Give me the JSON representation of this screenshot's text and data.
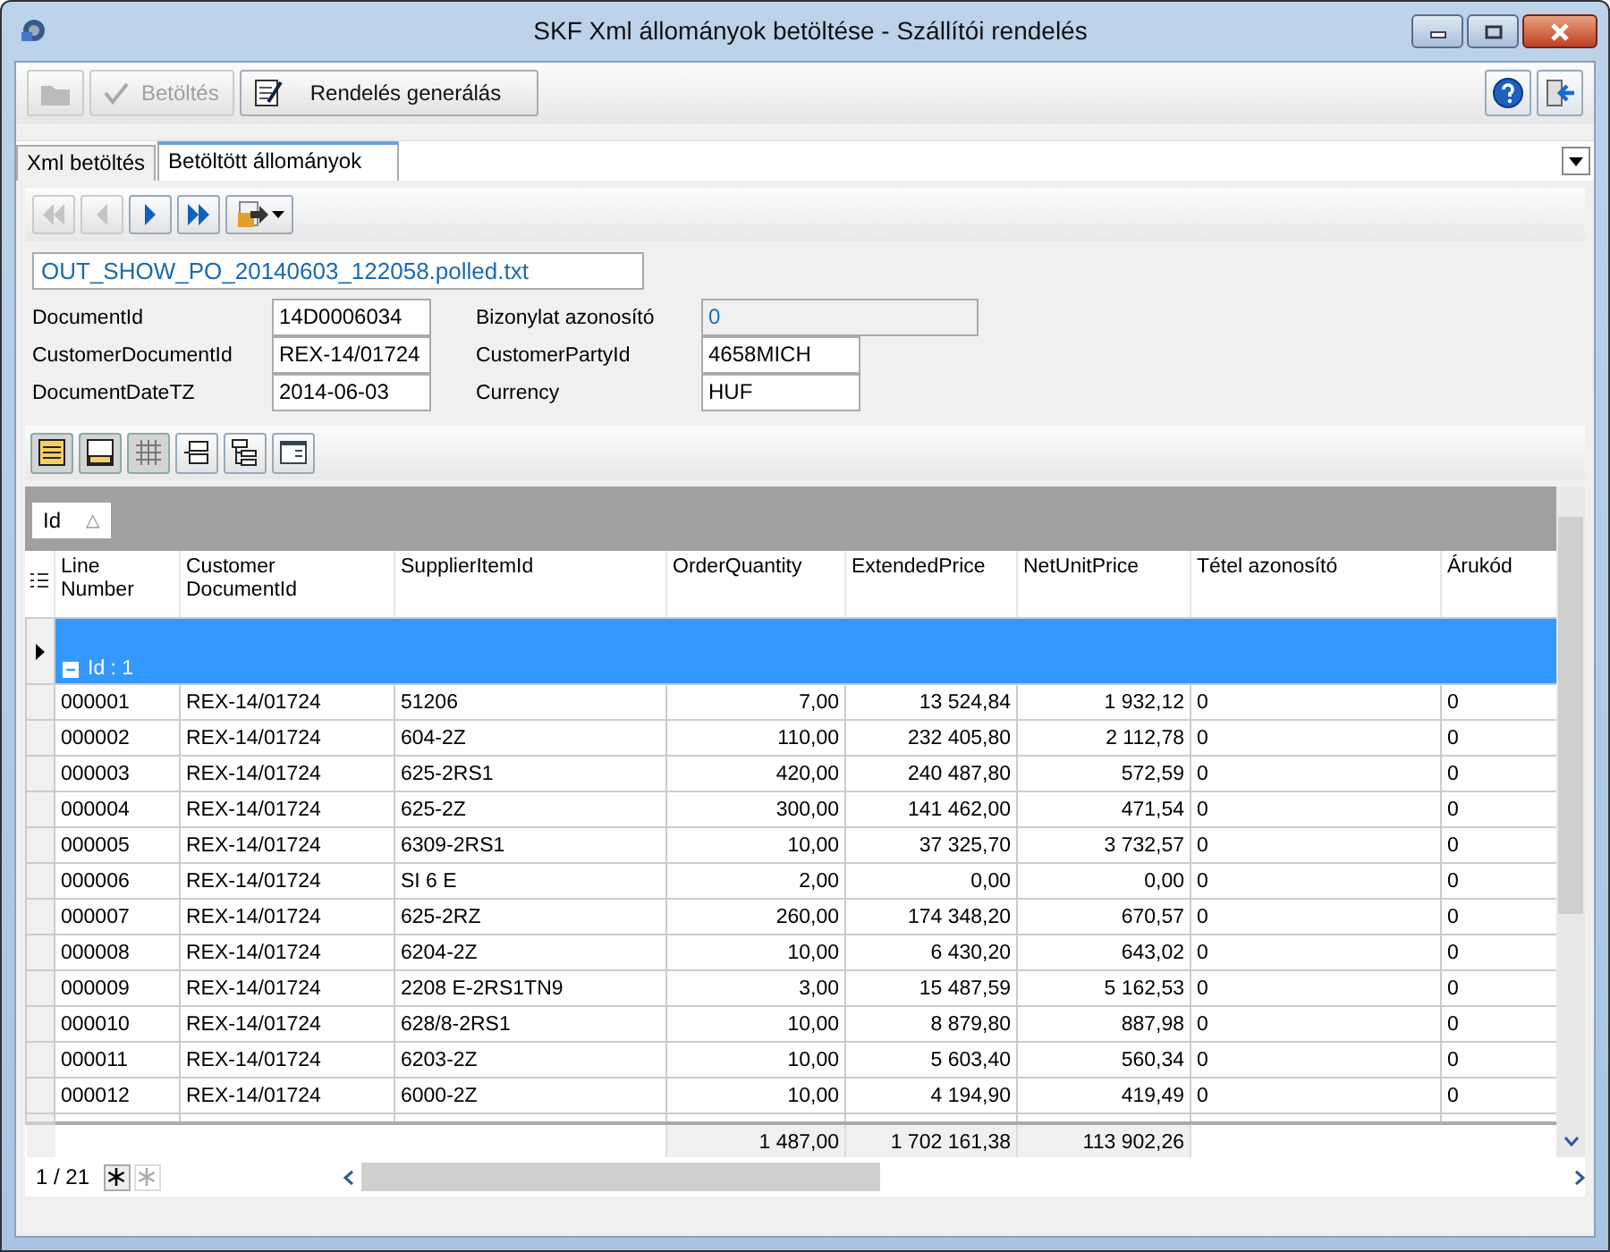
{
  "window": {
    "title": "SKF Xml állományok betöltése - Szállítói rendelés"
  },
  "toolbar": {
    "buttons": [
      {
        "kind": "open",
        "disabled": true
      },
      {
        "kind": "check",
        "label": "Betöltés",
        "disabled": true
      },
      {
        "kind": "generate",
        "label": "Rendelés generálás",
        "disabled": false
      }
    ],
    "right_buttons": [
      {
        "kind": "help"
      },
      {
        "kind": "exit"
      }
    ]
  },
  "tabs": [
    {
      "label": "Xml betöltés",
      "selected": false
    },
    {
      "label": "Betöltött állományok",
      "selected": true
    }
  ],
  "nav": [
    {
      "kind": "first",
      "disabled": true
    },
    {
      "kind": "prev",
      "disabled": true
    },
    {
      "kind": "next",
      "disabled": false
    },
    {
      "kind": "last",
      "disabled": false
    },
    {
      "kind": "export",
      "disabled": false
    }
  ],
  "file_name": "OUT_SHOW_PO_20140603_122058.polled.txt",
  "fields_left": [
    {
      "label": "DocumentId",
      "value": "14D0006034"
    },
    {
      "label": "CustomerDocumentId",
      "value": "REX-14/01724"
    },
    {
      "label": "DocumentDateTZ",
      "value": "2014-06-03"
    }
  ],
  "fields_right": [
    {
      "label": "Bizonylat azonosító",
      "value": "0",
      "disabled": true
    },
    {
      "label": "CustomerPartyId",
      "value": "4658MICH",
      "disabled": false
    },
    {
      "label": "Currency",
      "value": "HUF",
      "disabled": false
    }
  ],
  "view_buttons": [
    {
      "kind": "form",
      "pressed": true
    },
    {
      "kind": "footer",
      "pressed": true
    },
    {
      "kind": "grid",
      "pressed": true
    },
    {
      "kind": "group",
      "pressed": false
    },
    {
      "kind": "tree",
      "pressed": false
    },
    {
      "kind": "card",
      "pressed": false
    }
  ],
  "group_by": {
    "label": "Id",
    "sort": "△"
  },
  "table": {
    "columns": [
      {
        "label": "Line Number",
        "kind": "text"
      },
      {
        "label": "Customer DocumentId",
        "kind": "text"
      },
      {
        "label": "SupplierItemId",
        "kind": "text"
      },
      {
        "label": "OrderQuantity",
        "kind": "number"
      },
      {
        "label": "ExtendedPrice",
        "kind": "number"
      },
      {
        "label": "NetUnitPrice",
        "kind": "number"
      },
      {
        "label": "Tétel azonosító",
        "kind": "text"
      },
      {
        "label": "Árukód",
        "kind": "text"
      }
    ],
    "group": {
      "label": "Id : 1",
      "expanded": true
    },
    "rows": [
      [
        "000001",
        "REX-14/01724",
        "51206",
        "7,00",
        "13 524,84",
        "1 932,12",
        "0",
        "0"
      ],
      [
        "000002",
        "REX-14/01724",
        "604-2Z",
        "110,00",
        "232 405,80",
        "2 112,78",
        "0",
        "0"
      ],
      [
        "000003",
        "REX-14/01724",
        "625-2RS1",
        "420,00",
        "240 487,80",
        "572,59",
        "0",
        "0"
      ],
      [
        "000004",
        "REX-14/01724",
        "625-2Z",
        "300,00",
        "141 462,00",
        "471,54",
        "0",
        "0"
      ],
      [
        "000005",
        "REX-14/01724",
        "6309-2RS1",
        "10,00",
        "37 325,70",
        "3 732,57",
        "0",
        "0"
      ],
      [
        "000006",
        "REX-14/01724",
        "SI 6 E",
        "2,00",
        "0,00",
        "0,00",
        "0",
        "0"
      ],
      [
        "000007",
        "REX-14/01724",
        "625-2RZ",
        "260,00",
        "174 348,20",
        "670,57",
        "0",
        "0"
      ],
      [
        "000008",
        "REX-14/01724",
        "6204-2Z",
        "10,00",
        "6 430,20",
        "643,02",
        "0",
        "0"
      ],
      [
        "000009",
        "REX-14/01724",
        "2208 E-2RS1TN9",
        "3,00",
        "15 487,59",
        "5 162,53",
        "0",
        "0"
      ],
      [
        "000010",
        "REX-14/01724",
        "628/8-2RS1",
        "10,00",
        "8 879,80",
        "887,98",
        "0",
        "0"
      ],
      [
        "000011",
        "REX-14/01724",
        "6203-2Z",
        "10,00",
        "5 603,40",
        "560,34",
        "0",
        "0"
      ],
      [
        "000012",
        "REX-14/01724",
        "6000-2Z",
        "10,00",
        "4 194,90",
        "419,49",
        "0",
        "0"
      ]
    ],
    "totals": [
      "1 487,00",
      "1 702 161,38",
      "113 902,26"
    ]
  },
  "status_bar": {
    "record": "1 / 21"
  }
}
